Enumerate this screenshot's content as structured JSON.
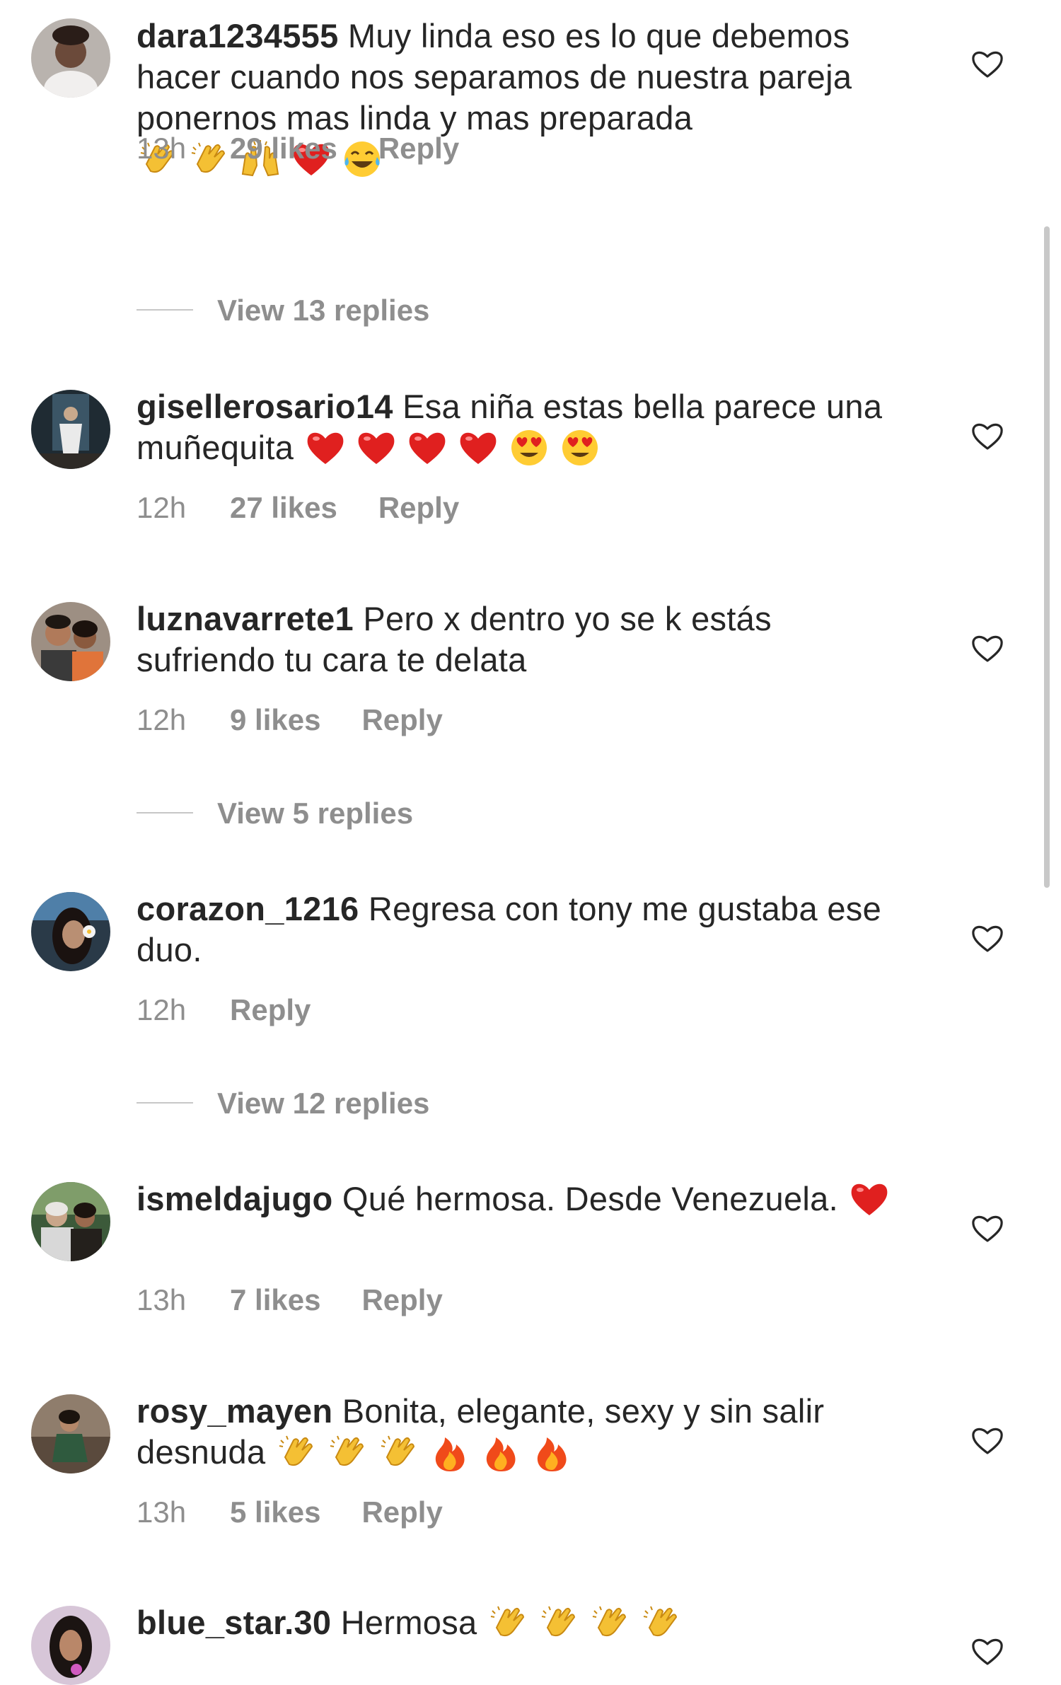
{
  "comments": [
    {
      "username": "dara1234555",
      "text": "Muy linda eso es lo que debemos hacer cuando nos separamos de nuestra pareja ponernos mas linda y mas preparada",
      "emojis": [
        "clapping-hands",
        "clapping-hands",
        "raising-hands",
        "red-heart",
        "tears-of-joy"
      ],
      "time": "13h",
      "likes": "29 likes",
      "reply": "Reply",
      "view_replies": "View 13 replies"
    },
    {
      "username": "gisellerosario14",
      "text": "Esa niña estas bella parece una muñequita",
      "emojis": [
        "red-heart",
        "red-heart",
        "red-heart",
        "red-heart",
        "heart-eyes",
        "heart-eyes"
      ],
      "time": "12h",
      "likes": "27 likes",
      "reply": "Reply"
    },
    {
      "username": "luznavarrete1",
      "text": "Pero x dentro yo se k estás sufriendo tu cara te delata",
      "emojis": [],
      "time": "12h",
      "likes": "9 likes",
      "reply": "Reply",
      "view_replies": "View 5 replies"
    },
    {
      "username": "corazon_1216",
      "text": "Regresa con tony me gustaba ese duo.",
      "emojis": [],
      "time": "12h",
      "reply": "Reply",
      "view_replies": "View 12 replies"
    },
    {
      "username": "ismeldajugo",
      "text": "Qué hermosa. Desde Venezuela.",
      "emojis": [
        "red-heart"
      ],
      "time": "13h",
      "likes": "7 likes",
      "reply": "Reply"
    },
    {
      "username": "rosy_mayen",
      "text": "Bonita, elegante, sexy  y sin salir desnuda",
      "emojis": [
        "clapping-hands",
        "clapping-hands",
        "clapping-hands",
        "fire",
        "fire",
        "fire"
      ],
      "time": "13h",
      "likes": "5 likes",
      "reply": "Reply"
    },
    {
      "username": "blue_star.30",
      "text": "Hermosa",
      "emojis": [
        "clapping-hands",
        "clapping-hands",
        "clapping-hands",
        "clapping-hands"
      ]
    }
  ],
  "icons": {
    "like": "heart-outline-icon"
  },
  "colors": {
    "text": "#262626",
    "secondary": "#8e8e8e",
    "divider": "#c7c7c7"
  }
}
